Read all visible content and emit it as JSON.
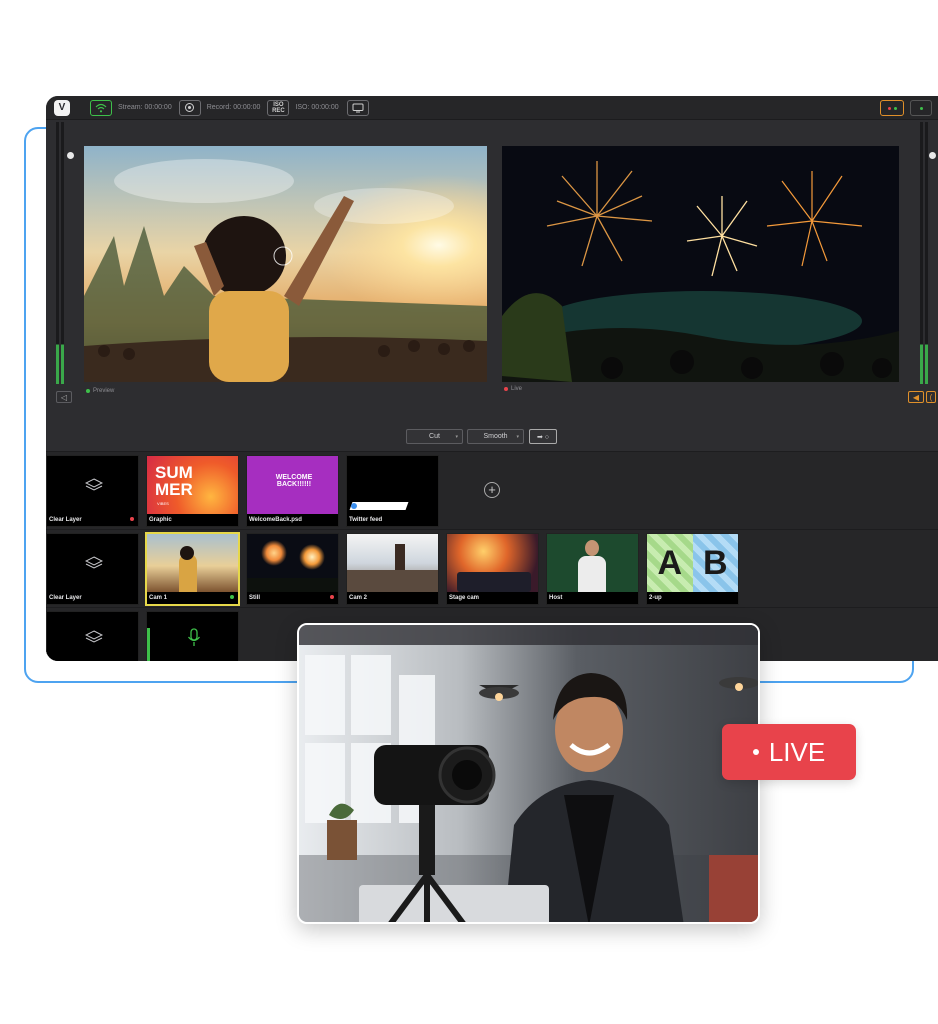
{
  "toolbar": {
    "stream_label": "Stream:",
    "stream_time": "00:00:00",
    "record_label": "Record:",
    "record_time": "00:00:00",
    "iso_label": "ISO:",
    "iso_time": "00:00:00",
    "iso_badge_top": "ISO",
    "iso_badge_bottom": "REC"
  },
  "monitors": {
    "preview_label": "Preview",
    "live_label": "Live"
  },
  "meters": {
    "left_scale": [
      "-6",
      "-12",
      "-18",
      "-24",
      "-30"
    ],
    "right_scale": [
      "-6",
      "-12",
      "-18",
      "-24",
      "-30"
    ]
  },
  "transition": {
    "cut_label": "Cut",
    "smooth_label": "Smooth",
    "arrow_label": "➡ ○"
  },
  "rows": {
    "row1": [
      {
        "label": "Clear Layer"
      },
      {
        "label": "Graphic"
      },
      {
        "label": "WelcomeBack.psd"
      },
      {
        "label": "Twitter feed"
      }
    ],
    "row2": [
      {
        "label": "Clear Layer"
      },
      {
        "label": "Cam 1"
      },
      {
        "label": "Still"
      },
      {
        "label": "Cam 2"
      },
      {
        "label": "Stage cam"
      },
      {
        "label": "Host"
      },
      {
        "label": "2-up"
      }
    ]
  },
  "thumbnails": {
    "summer_line1": "SUM",
    "summer_line2": "MER",
    "summer_small": "VIBES",
    "welcome_text": "WELCOME BACK!!!!!!",
    "ab_a": "A",
    "ab_b": "B"
  },
  "badge": {
    "live_text": "LIVE"
  },
  "colors": {
    "accent_blue": "#4da3f0",
    "live_red": "#e8434b",
    "active_yellow": "#e6d84a",
    "stream_green": "#3ec04a",
    "app_bg": "#2d2d30"
  }
}
